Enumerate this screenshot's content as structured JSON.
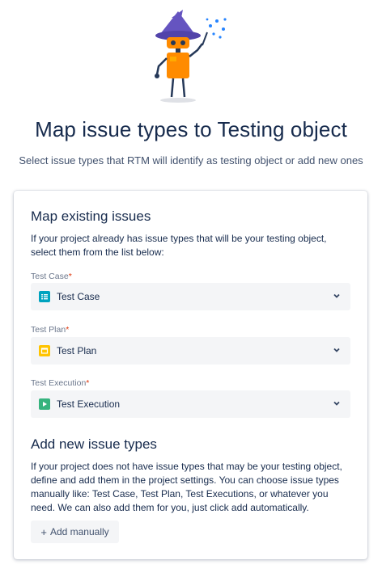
{
  "header": {
    "title": "Map issue types to Testing object",
    "subtitle": "Select issue types that RTM will identify as testing object or add new ones"
  },
  "map_existing": {
    "title": "Map existing issues",
    "description": "If your project already has issue types that will be your testing object, select them from the list below:",
    "fields": [
      {
        "label": "Test Case",
        "required_mark": "*",
        "value": "Test Case",
        "icon": "test-case-icon",
        "icon_color": "#00a3bf"
      },
      {
        "label": "Test Plan",
        "required_mark": "*",
        "value": "Test Plan",
        "icon": "test-plan-icon",
        "icon_color": "#ffc400"
      },
      {
        "label": "Test Execution",
        "required_mark": "*",
        "value": "Test Execution",
        "icon": "test-execution-icon",
        "icon_color": "#36b37e"
      }
    ]
  },
  "add_new": {
    "title": "Add new issue types",
    "description": "If your project does not have issue types that may be your testing object, define and add them in the project settings. You can choose issue types manually like: Test Case, Test Plan, Test Executions, or whatever you need. We can also add them for you, just click add automatically.",
    "button_label": "Add manually",
    "button_icon": "plus-icon"
  },
  "colors": {
    "text": "#172b4d",
    "subtle": "#6b778c",
    "required": "#de350b",
    "field_bg": "#f4f5f7"
  }
}
